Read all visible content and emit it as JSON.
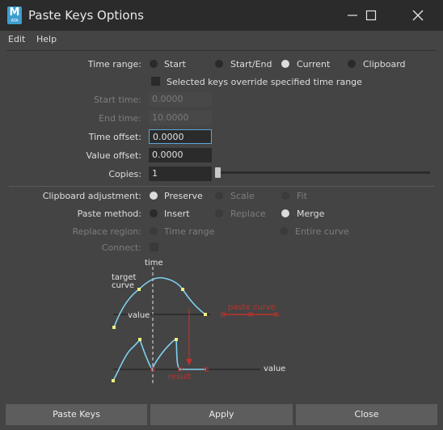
{
  "window": {
    "title": "Paste Keys Options",
    "icon_letter": "M",
    "icon_sub": "ATA",
    "icon": "maya-app-icon"
  },
  "menu": [
    "Edit",
    "Help"
  ],
  "time_range": {
    "label": "Time range:",
    "options": [
      "Start",
      "Start/End",
      "Current",
      "Clipboard"
    ],
    "selected": "Current"
  },
  "override_label": "Selected keys override specified time range",
  "start_time": {
    "label": "Start time:",
    "value": "0.0000"
  },
  "end_time": {
    "label": "End time:",
    "value": "10.0000"
  },
  "time_offset": {
    "label": "Time offset:",
    "value": "0.0000"
  },
  "value_offset": {
    "label": "Value offset:",
    "value": "0.0000"
  },
  "copies": {
    "label": "Copies:",
    "value": "1",
    "slider_fraction": 0.0
  },
  "clipboard_adjustment": {
    "label": "Clipboard adjustment:",
    "options": [
      "Preserve",
      "Scale",
      "Fit"
    ],
    "selected": "Preserve"
  },
  "paste_method": {
    "label": "Paste method:",
    "options": [
      "Insert",
      "Replace",
      "Merge"
    ],
    "selected": "Merge"
  },
  "replace_region": {
    "label": "Replace region:",
    "options": [
      "Time range",
      "Entire curve"
    ]
  },
  "connect": {
    "label": "Connect:"
  },
  "diagram": {
    "time": "time",
    "target_curve": "target",
    "target_curve_2": "curve",
    "value_top": "value",
    "paste_curve": "paste curve",
    "result": "result",
    "value_bottom": "value",
    "curve_color": "#7fd0f0",
    "paste_color": "#c0302a"
  },
  "buttons": {
    "paste_keys": "Paste Keys",
    "apply": "Apply",
    "close": "Close"
  }
}
